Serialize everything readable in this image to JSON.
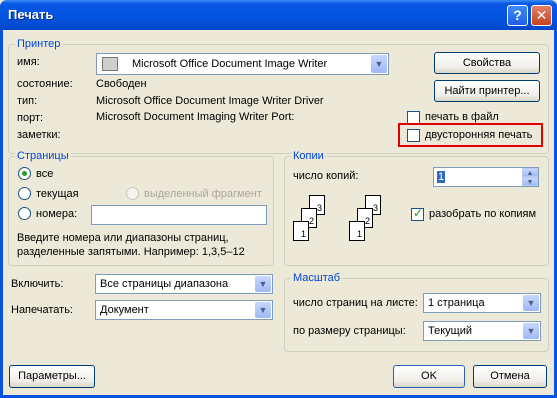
{
  "window": {
    "title": "Печать",
    "help_label": "?",
    "close_label": "✕"
  },
  "printer": {
    "legend": "Принтер",
    "name_label": "имя:",
    "name_value": "Microsoft Office Document Image Writer",
    "status_label": "состояние:",
    "status_value": "Свободен",
    "type_label": "тип:",
    "type_value": "Microsoft Office Document Image Writer Driver",
    "port_label": "порт:",
    "port_value": "Microsoft Document Imaging Writer Port:",
    "notes_label": "заметки:",
    "properties_button": "Свойства",
    "find_printer_button": "Найти принтер...",
    "print_to_file_label": "печать в файл",
    "duplex_label": "двусторонняя печать"
  },
  "pages": {
    "legend": "Страницы",
    "all_label": "все",
    "current_label": "текущая",
    "selection_label": "выделенный фрагмент",
    "numbers_label": "номера:",
    "numbers_value": "",
    "hint": "Введите номера или диапазоны страниц, разделенные запятыми. Например: 1,3,5–12"
  },
  "copies": {
    "legend": "Копии",
    "count_label": "число копий:",
    "count_value": "1",
    "collate_label": "разобрать по копиям",
    "collate_checked": true,
    "page_numbers": [
      "1",
      "2",
      "3"
    ]
  },
  "include": {
    "label": "Включить:",
    "value": "Все страницы диапазона"
  },
  "print_what": {
    "label": "Напечатать:",
    "value": "Документ"
  },
  "scale": {
    "legend": "Масштаб",
    "pages_per_sheet_label": "число страниц на листе:",
    "pages_per_sheet_value": "1 страница",
    "fit_label": "по размеру страницы:",
    "fit_value": "Текущий"
  },
  "footer": {
    "options_button": "Параметры...",
    "ok_button": "OK",
    "cancel_button": "Отмена"
  },
  "colors": {
    "title_bar": "#0453e0",
    "legend": "#0046d5",
    "highlight": "#e00000"
  }
}
